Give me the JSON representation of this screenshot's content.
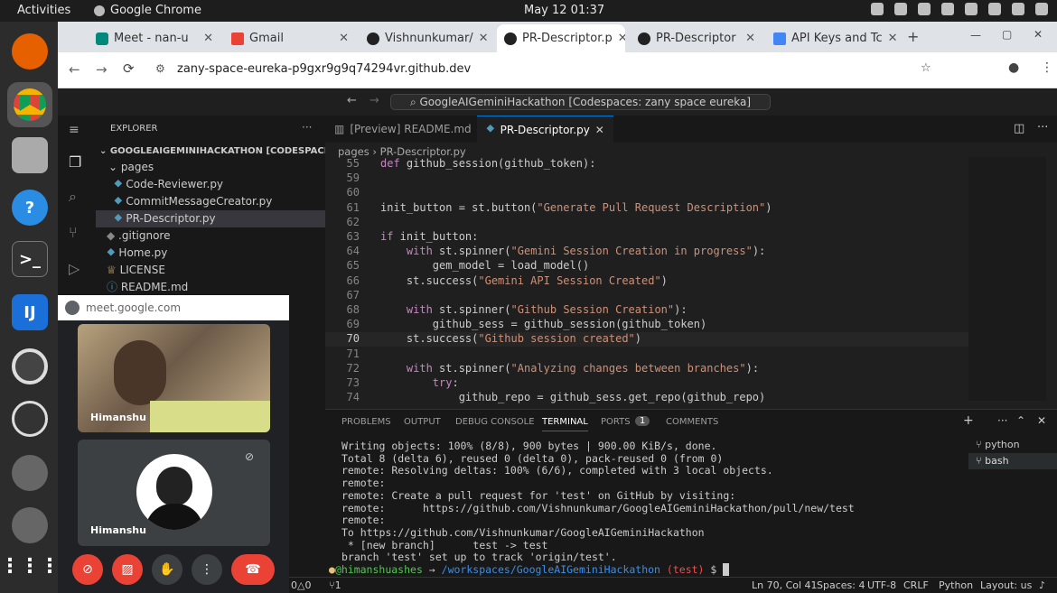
{
  "topbar": {
    "activities": "Activities",
    "app": "Google Chrome",
    "clock": "May 12  01:37"
  },
  "chrome": {
    "tabs": [
      {
        "label": "Meet - nan-u",
        "icon": "meet-icon"
      },
      {
        "label": "Gmail",
        "icon": "gmail-icon"
      },
      {
        "label": "Vishnunkumar/",
        "icon": "github-icon"
      },
      {
        "label": "PR-Descriptor.p",
        "icon": "github-icon"
      },
      {
        "label": "PR-Descriptor",
        "icon": "github-icon"
      },
      {
        "label": "API Keys and Tc",
        "icon": "doc-icon"
      }
    ],
    "url": "zany-space-eureka-p9gxr9g9q74294vr.github.dev"
  },
  "vscode": {
    "command_center": "GoogleAIGeminiHackathon [Codespaces: zany space eureka]",
    "explorer_title": "EXPLORER",
    "workspace": "GOOGLEAIGEMINIHACKATHON [CODESPACES: ZA...",
    "tree": [
      {
        "label": "pages",
        "indent": 1
      },
      {
        "label": "Code-Reviewer.py",
        "indent": 2
      },
      {
        "label": "CommitMessageCreator.py",
        "indent": 2
      },
      {
        "label": "PR-Descriptor.py",
        "indent": 2
      },
      {
        "label": ".gitignore",
        "indent": 1
      },
      {
        "label": "Home.py",
        "indent": 1
      },
      {
        "label": "LICENSE",
        "indent": 1
      },
      {
        "label": "README.md",
        "indent": 1
      }
    ],
    "editor_tabs": [
      "[Preview] README.md",
      "PR-Descriptor.py"
    ],
    "breadcrumb": [
      "pages",
      "PR-Descriptor.py"
    ],
    "code": [
      {
        "ln": "55",
        "text": "def github_session(github_token):"
      },
      {
        "ln": "59",
        "text": ""
      },
      {
        "ln": "60",
        "text": ""
      },
      {
        "ln": "61",
        "text": "init_button = st.button(\"Generate Pull Request Description\")"
      },
      {
        "ln": "62",
        "text": ""
      },
      {
        "ln": "63",
        "text": "if init_button:"
      },
      {
        "ln": "64",
        "text": "    with st.spinner(\"Gemini Session Creation in progress\"):"
      },
      {
        "ln": "65",
        "text": "        gem_model = load_model()"
      },
      {
        "ln": "66",
        "text": "    st.success(\"Gemini API Session Created\")"
      },
      {
        "ln": "67",
        "text": ""
      },
      {
        "ln": "68",
        "text": "    with st.spinner(\"Github Session Creation\"):"
      },
      {
        "ln": "69",
        "text": "        github_sess = github_session(github_token)"
      },
      {
        "ln": "70",
        "text": "    st.success(\"Github session created\")"
      },
      {
        "ln": "71",
        "text": ""
      },
      {
        "ln": "72",
        "text": "    with st.spinner(\"Analyzing changes between branches\"):"
      },
      {
        "ln": "73",
        "text": "        try:"
      },
      {
        "ln": "74",
        "text": "            github_repo = github_sess.get_repo(github_repo)"
      }
    ],
    "panel_tabs": [
      "PROBLEMS",
      "OUTPUT",
      "DEBUG CONSOLE",
      "TERMINAL",
      "PORTS",
      "COMMENTS"
    ],
    "ports_count": "1",
    "terminal_sessions": [
      "python",
      "bash"
    ],
    "terminal": [
      "Writing objects: 100% (8/8), 900 bytes | 900.00 KiB/s, done.",
      "Total 8 (delta 6), reused 0 (delta 0), pack-reused 0 (from 0)",
      "remote: Resolving deltas: 100% (6/6), completed with 3 local objects.",
      "remote:",
      "remote: Create a pull request for 'test' on GitHub by visiting:",
      "remote:      https://github.com/Vishnunkumar/GoogleAIGeminiHackathon/pull/new/test",
      "remote:",
      "To https://github.com/Vishnunkumar/GoogleAIGeminiHackathon",
      " * [new branch]      test -> test",
      "branch 'test' set up to track 'origin/test'."
    ],
    "prompt_user": "@himanshuashes",
    "prompt_path": "/workspaces/GoogleAIGeminiHackathon",
    "prompt_branch": "(test)",
    "prompt_sym": "$",
    "status": {
      "errors": "0",
      "warnings": "0",
      "ports": "1",
      "position": "Ln 70, Col 41",
      "spaces": "Spaces: 4",
      "encoding": "UTF-8",
      "eol": "CRLF",
      "language": "Python",
      "layout": "Layout: us"
    }
  },
  "meet": {
    "url": "meet.google.com",
    "participants": [
      {
        "name": "Himanshu"
      },
      {
        "name": "Himanshu"
      }
    ]
  }
}
